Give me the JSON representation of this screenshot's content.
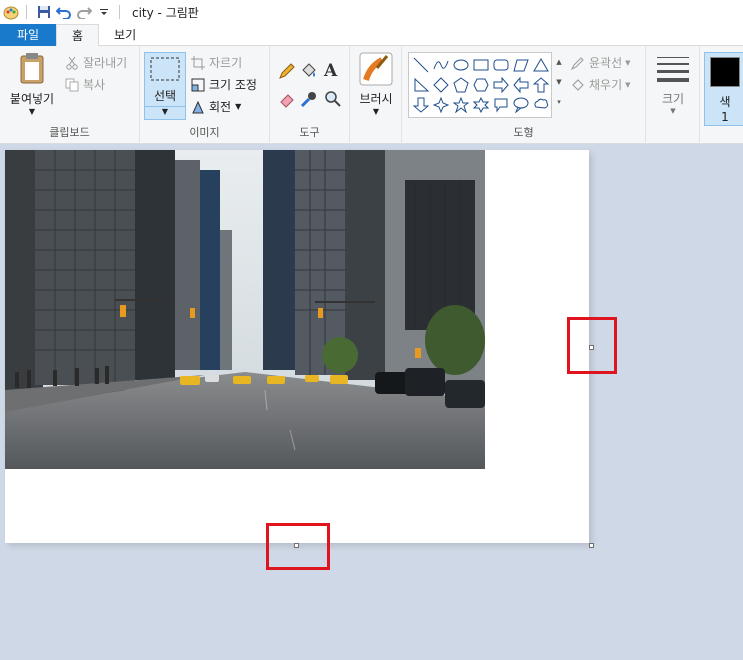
{
  "window": {
    "title": "city - 그림판"
  },
  "quick_access": {
    "icons": [
      "paint-app-icon",
      "save-icon",
      "undo-icon",
      "redo-icon",
      "customize-dropdown-icon"
    ]
  },
  "tabs": [
    {
      "label": "파일"
    },
    {
      "label": "홈"
    },
    {
      "label": "보기"
    }
  ],
  "ribbon": {
    "clipboard": {
      "label": "클립보드",
      "paste": "붙여넣기",
      "cut": "잘라내기",
      "copy": "복사"
    },
    "image": {
      "label": "이미지",
      "select": "선택",
      "crop": "자르기",
      "resize": "크기 조정",
      "rotate": "회전"
    },
    "tools": {
      "label": "도구"
    },
    "brush": {
      "label": "브러시"
    },
    "shapes": {
      "label": "도형",
      "outline": "윤곽선",
      "fill": "채우기"
    },
    "size": {
      "label": "크기"
    },
    "color1": {
      "label": "색",
      "number": "1"
    }
  }
}
